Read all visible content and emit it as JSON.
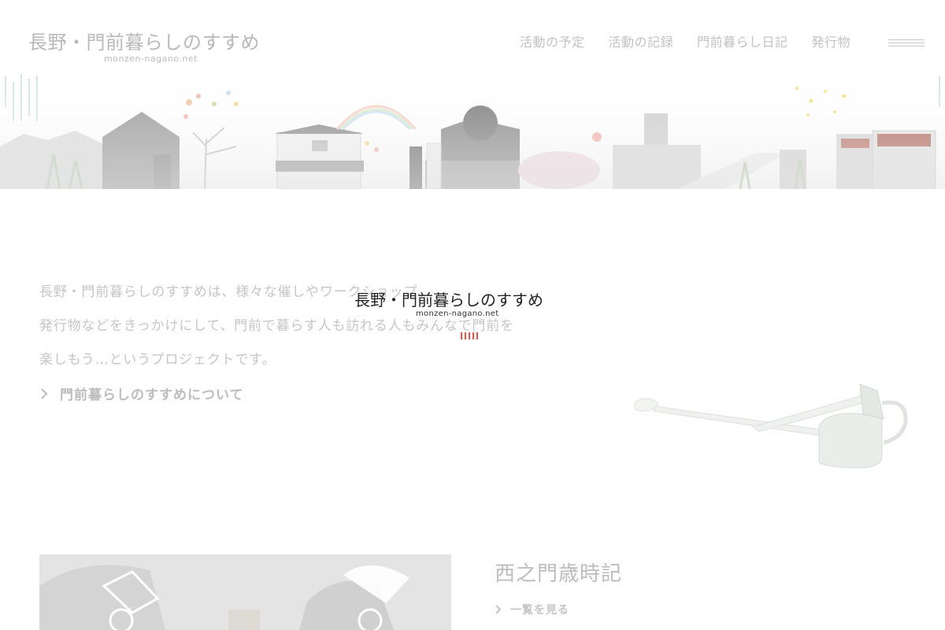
{
  "header": {
    "logo_main": "長野・門前暮らしのすすめ",
    "logo_sub": "monzen-nagano.net",
    "nav": [
      {
        "label": "活動の予定"
      },
      {
        "label": "活動の記録"
      },
      {
        "label": "門前暮らし日記"
      },
      {
        "label": "発行物"
      }
    ],
    "menu_icon": "hamburger-icon"
  },
  "intro": {
    "lines": [
      "長野・門前暮らしのすすめは、様々な催しやワークショップ、",
      "発行物などをきっかけにして、門前で暮らす人も訪れる人もみんなで門前を",
      "楽しもう…というプロジェクトです。"
    ],
    "about_link": "門前暮らしのすすめについて"
  },
  "overlay": {
    "logo_main": "長野・門前暮らしのすすめ",
    "logo_sub": "monzen-nagano.net",
    "bar_color": "#e0584a"
  },
  "section": {
    "title": "西之門歳時記",
    "more_link": "一覧を見る"
  }
}
